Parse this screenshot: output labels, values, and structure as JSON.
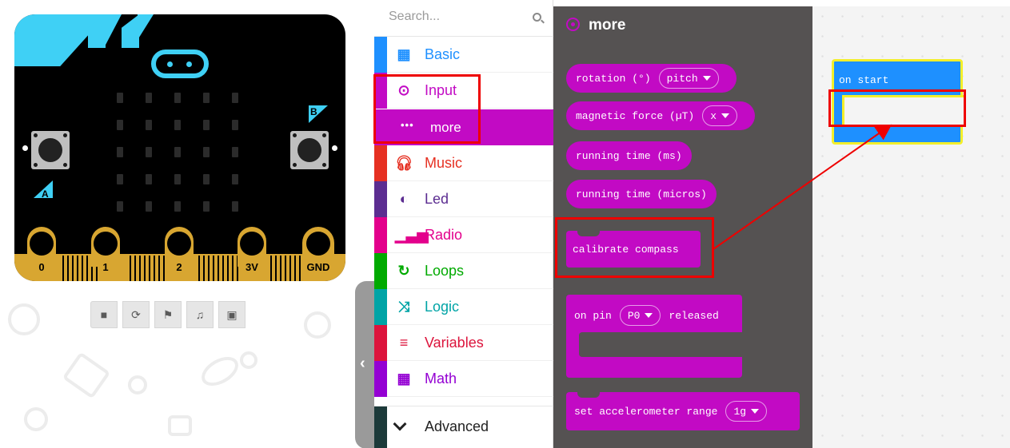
{
  "simulator": {
    "pins": [
      "0",
      "1",
      "2",
      "3V",
      "GND"
    ],
    "button_a": "A",
    "button_b": "B",
    "controls": [
      {
        "icon": "stop-icon"
      },
      {
        "icon": "restart-icon"
      },
      {
        "icon": "debug-icon"
      },
      {
        "icon": "sound-icon"
      },
      {
        "icon": "screenshot-icon"
      }
    ]
  },
  "toolbox": {
    "search": {
      "placeholder": "Search..."
    },
    "categories": [
      {
        "label": "Basic",
        "color": "#1e90ff",
        "icon": "grid-icon"
      },
      {
        "label": "Input",
        "color": "#c20ac4",
        "icon": "input-icon"
      },
      {
        "label": "Music",
        "color": "#e63022",
        "icon": "headphones-icon"
      },
      {
        "label": "Led",
        "color": "#5c2d91",
        "icon": "toggle-icon"
      },
      {
        "label": "Radio",
        "color": "#e3008c",
        "icon": "signal-icon"
      },
      {
        "label": "Loops",
        "color": "#00aa00",
        "icon": "loop-icon"
      },
      {
        "label": "Logic",
        "color": "#00a4a6",
        "icon": "shuffle-icon"
      },
      {
        "label": "Variables",
        "color": "#dc143c",
        "icon": "list-icon"
      },
      {
        "label": "Math",
        "color": "#9400d3",
        "icon": "calculator-icon"
      }
    ],
    "more": {
      "label": "more",
      "icon": "more-icon"
    },
    "advanced": {
      "label": "Advanced",
      "icon": "chevron-down-icon"
    }
  },
  "flyout": {
    "title": "more",
    "accent": "#c20ac4",
    "blocks": {
      "rotation": {
        "label": "rotation (°)",
        "value": "pitch"
      },
      "magnetic": {
        "label": "magnetic force (µT)",
        "value": "x"
      },
      "running_ms": {
        "label": "running time (ms)"
      },
      "running_micros": {
        "label": "running time (micros)"
      },
      "calibrate": {
        "label": "calibrate compass"
      },
      "on_pin": {
        "label": "on pin",
        "value": "P0",
        "suffix": "released"
      },
      "accel": {
        "label": "set accelerometer range",
        "value": "1g"
      }
    }
  },
  "workspace": {
    "on_start": {
      "label": "on start",
      "color": "#1e90ff"
    }
  },
  "annotation": {
    "color": "#e00000"
  }
}
